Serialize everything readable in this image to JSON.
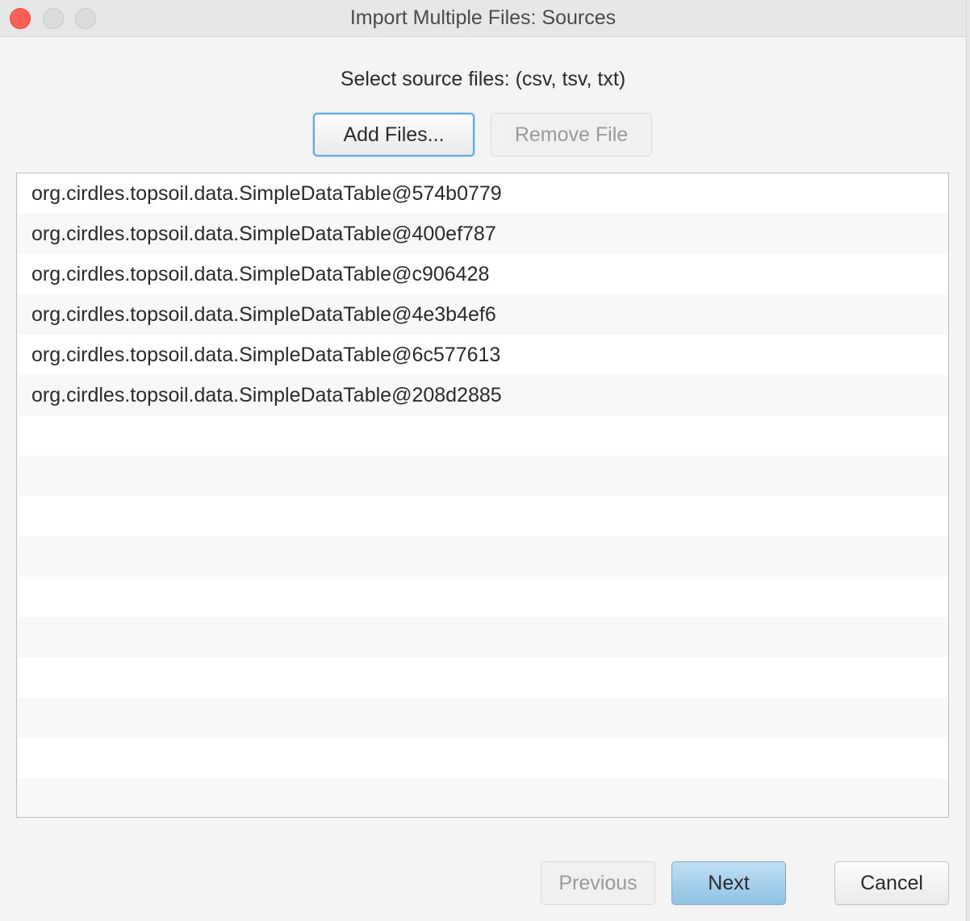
{
  "window": {
    "title": "Import Multiple Files: Sources"
  },
  "prompt": "Select source files: (csv, tsv, txt)",
  "toolbar": {
    "add_files_label": "Add Files...",
    "remove_file_label": "Remove File"
  },
  "files": [
    "org.cirdles.topsoil.data.SimpleDataTable@574b0779",
    "org.cirdles.topsoil.data.SimpleDataTable@400ef787",
    "org.cirdles.topsoil.data.SimpleDataTable@c906428",
    "org.cirdles.topsoil.data.SimpleDataTable@4e3b4ef6",
    "org.cirdles.topsoil.data.SimpleDataTable@6c577613",
    "org.cirdles.topsoil.data.SimpleDataTable@208d2885",
    "",
    "",
    "",
    "",
    "",
    "",
    "",
    "",
    "",
    ""
  ],
  "footer": {
    "previous_label": "Previous",
    "next_label": "Next",
    "cancel_label": "Cancel"
  },
  "colors": {
    "close": "#ff5f57",
    "accent": "#5fa9dd",
    "default_button": "#a6d0ea"
  }
}
